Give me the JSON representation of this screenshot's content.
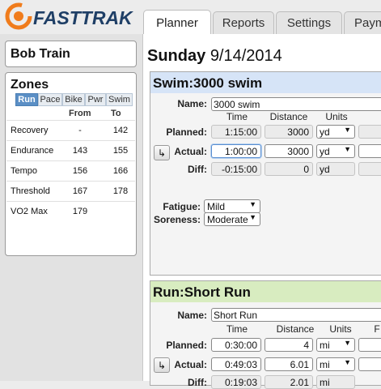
{
  "app": {
    "logo_text": "FASTTRAK"
  },
  "tabs": [
    {
      "label": "Planner",
      "active": true
    },
    {
      "label": "Reports",
      "active": false
    },
    {
      "label": "Settings",
      "active": false
    },
    {
      "label": "Paym",
      "active": false
    }
  ],
  "athlete": {
    "name": "Bob Train"
  },
  "zones": {
    "title": "Zones",
    "tabs": [
      "Run",
      "Pace",
      "Bike",
      "Pwr",
      "Swim"
    ],
    "active_tab": "Run",
    "col_from": "From",
    "col_to": "To",
    "rows": [
      {
        "name": "Recovery",
        "from": "-",
        "to": "142"
      },
      {
        "name": "Endurance",
        "from": "143",
        "to": "155"
      },
      {
        "name": "Tempo",
        "from": "156",
        "to": "166"
      },
      {
        "name": "Threshold",
        "from": "167",
        "to": "178"
      },
      {
        "name": "VO2 Max",
        "from": "179",
        "to": ""
      }
    ]
  },
  "day": {
    "weekday": "Sunday",
    "date": "9/14/2014"
  },
  "workouts": [
    {
      "header": "Swim:3000 swim",
      "header_color": "#d6e4f7",
      "name_label": "Name:",
      "name": "3000 swim",
      "cols": {
        "time": "Time",
        "distance": "Distance",
        "units": "Units"
      },
      "planned_label": "Planned:",
      "actual_label": "Actual:",
      "diff_label": "Diff:",
      "planned": {
        "time": "1:15:00",
        "distance": "3000",
        "units": "yd"
      },
      "actual": {
        "time": "1:00:00",
        "distance": "3000",
        "units": "yd"
      },
      "diff": {
        "time": "-0:15:00",
        "distance": "0",
        "units": "yd"
      },
      "fatigue_label": "Fatigue:",
      "fatigue": "Mild",
      "soreness_label": "Soreness:",
      "soreness": "Moderate"
    },
    {
      "header": "Run:Short Run",
      "header_color": "#d8ecc0",
      "name_label": "Name:",
      "name": "Short Run",
      "cols": {
        "time": "Time",
        "distance": "Distance",
        "units": "Units",
        "extra": "F"
      },
      "planned_label": "Planned:",
      "actual_label": "Actual:",
      "diff_label": "Diff:",
      "planned": {
        "time": "0:30:00",
        "distance": "4",
        "units": "mi"
      },
      "actual": {
        "time": "0:49:03",
        "distance": "6.01",
        "units": "mi"
      },
      "diff": {
        "time": "0:19:03",
        "distance": "2.01",
        "units": "mi"
      }
    }
  ]
}
